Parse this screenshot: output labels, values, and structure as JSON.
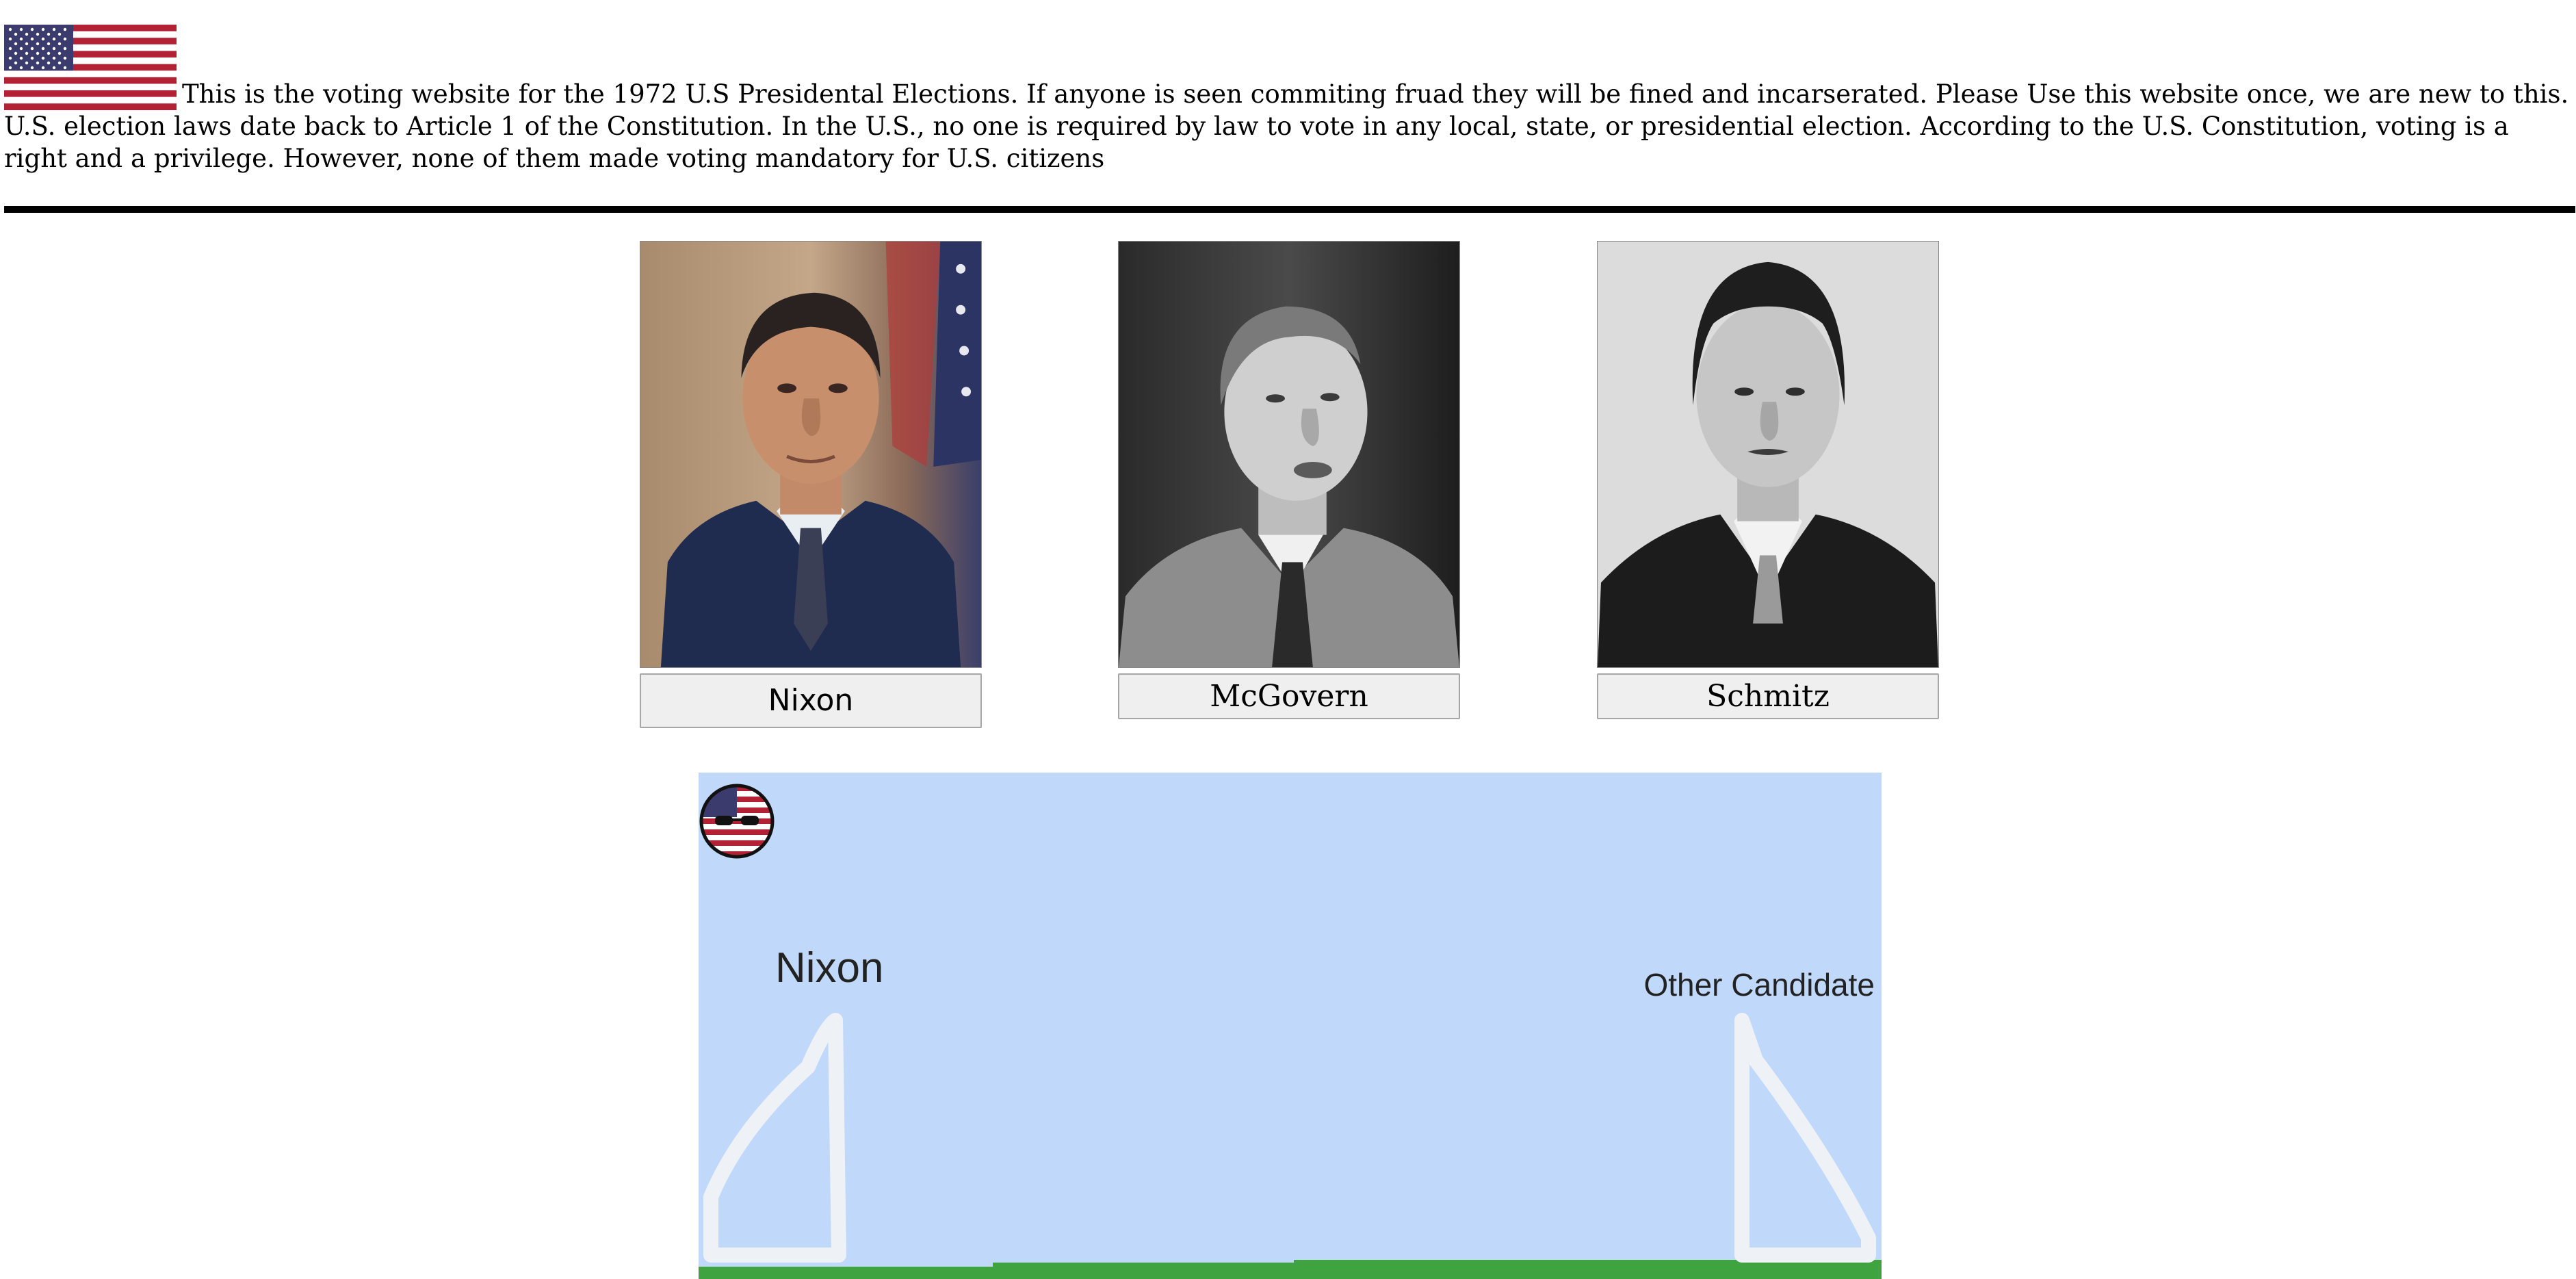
{
  "header": {
    "intro_text": "This is the voting website for the 1972 U.S Presidental Elections. If anyone is seen commiting fruad they will be fined and incarserated. Please Use this website once, we are new to this. U.S. election laws date back to Article 1 of the Constitution. In the U.S., no one is required by law to vote in any local, state, or presidential election. According to the U.S. Constitution, voting is a right and a privilege. However, none of them made voting mandatory for U.S. citizens"
  },
  "candidates": [
    {
      "name": "Nixon",
      "button_label": "Nixon"
    },
    {
      "name": "McGovern",
      "button_label": "McGovern"
    },
    {
      "name": "Schmitz",
      "button_label": "Schmitz"
    }
  ],
  "game": {
    "left_label": "Nixon",
    "right_label": "Other Candidate"
  },
  "colors": {
    "sky": "#c0d8fa",
    "ground": "#3fa33f",
    "flag_red": "#b22234",
    "flag_blue": "#3c3b6e"
  }
}
